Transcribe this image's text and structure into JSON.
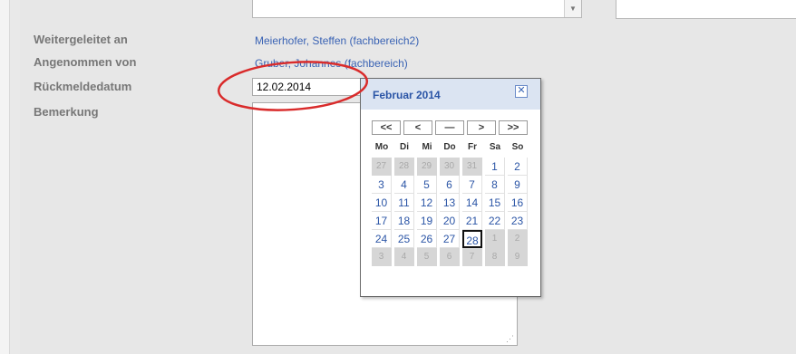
{
  "form": {
    "weitergeleitet_label": "Weitergeleitet an",
    "weitergeleitet_value": "Meierhofer, Steffen (fachbereich2)",
    "angenommen_label": "Angenommen von",
    "angenommen_value": "Gruber, Johannes (fachbereich)",
    "rueckmeldedatum_label": "Rückmeldedatum",
    "rueckmeldedatum_value": "12.02.2014",
    "bemerkung_label": "Bemerkung"
  },
  "calendar": {
    "title": "Februar 2014",
    "close_icon": "close-icon",
    "nav": [
      "<<",
      "<",
      "—",
      ">",
      ">>"
    ],
    "weekdays": [
      "Mo",
      "Di",
      "Mi",
      "Do",
      "Fr",
      "Sa",
      "So"
    ],
    "days": [
      {
        "d": "27",
        "off": true
      },
      {
        "d": "28",
        "off": true
      },
      {
        "d": "29",
        "off": true
      },
      {
        "d": "30",
        "off": true
      },
      {
        "d": "31",
        "off": true
      },
      {
        "d": "1",
        "off": false
      },
      {
        "d": "2",
        "off": false
      },
      {
        "d": "3",
        "off": false
      },
      {
        "d": "4",
        "off": false
      },
      {
        "d": "5",
        "off": false
      },
      {
        "d": "6",
        "off": false
      },
      {
        "d": "7",
        "off": false
      },
      {
        "d": "8",
        "off": false
      },
      {
        "d": "9",
        "off": false
      },
      {
        "d": "10",
        "off": false
      },
      {
        "d": "11",
        "off": false
      },
      {
        "d": "12",
        "off": false
      },
      {
        "d": "13",
        "off": false
      },
      {
        "d": "14",
        "off": false
      },
      {
        "d": "15",
        "off": false
      },
      {
        "d": "16",
        "off": false
      },
      {
        "d": "17",
        "off": false
      },
      {
        "d": "18",
        "off": false
      },
      {
        "d": "19",
        "off": false
      },
      {
        "d": "20",
        "off": false
      },
      {
        "d": "21",
        "off": false
      },
      {
        "d": "22",
        "off": false
      },
      {
        "d": "23",
        "off": false
      },
      {
        "d": "24",
        "off": false
      },
      {
        "d": "25",
        "off": false
      },
      {
        "d": "26",
        "off": false
      },
      {
        "d": "27",
        "off": false
      },
      {
        "d": "28",
        "off": false,
        "today": true
      },
      {
        "d": "1",
        "off": true
      },
      {
        "d": "2",
        "off": true
      },
      {
        "d": "3",
        "off": true
      },
      {
        "d": "4",
        "off": true
      },
      {
        "d": "5",
        "off": true
      },
      {
        "d": "6",
        "off": true
      },
      {
        "d": "7",
        "off": true
      },
      {
        "d": "8",
        "off": true
      },
      {
        "d": "9",
        "off": true
      }
    ]
  },
  "colors": {
    "link": "#3a63b4",
    "label": "#777777",
    "calendar_header": "#dbe4f2",
    "annotation": "#d92b2b"
  }
}
